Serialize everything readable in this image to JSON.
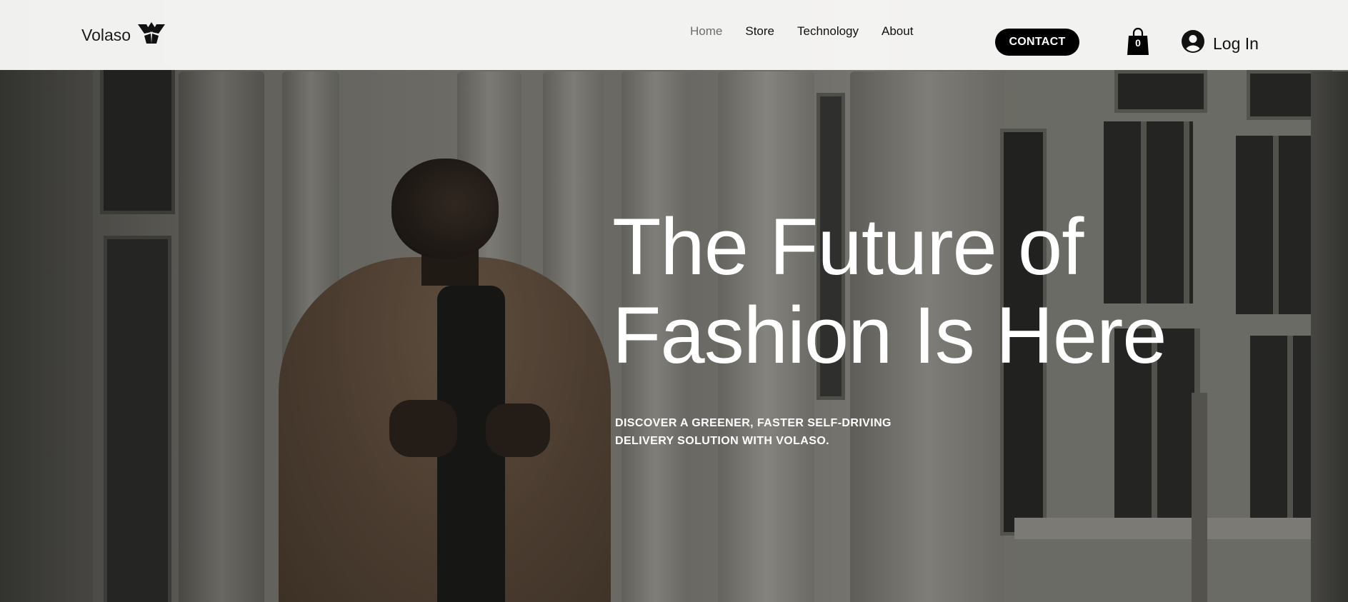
{
  "brand": {
    "name": "Volaso",
    "logo_icon": "volaso-logo-icon"
  },
  "nav": {
    "items": [
      {
        "label": "Home",
        "active": true
      },
      {
        "label": "Store",
        "active": false
      },
      {
        "label": "Technology",
        "active": false
      },
      {
        "label": "About",
        "active": false
      }
    ]
  },
  "header": {
    "contact_label": "CONTACT",
    "cart_count": "0",
    "cart_icon": "shopping-bag-icon",
    "login_label": "Log In",
    "login_icon": "user-avatar-icon"
  },
  "hero": {
    "title_line1": "The Future of",
    "title_line2": "Fashion Is Here",
    "subtitle_line1": "DISCOVER A GREENER, FASTER SELF-DRIVING",
    "subtitle_line2": "DELIVERY SOLUTION WITH VOLASO."
  },
  "colors": {
    "header_bg": "#f7f7f6",
    "accent": "#000000",
    "nav_active": "#6d6d6d",
    "hero_text": "#ffffff"
  }
}
